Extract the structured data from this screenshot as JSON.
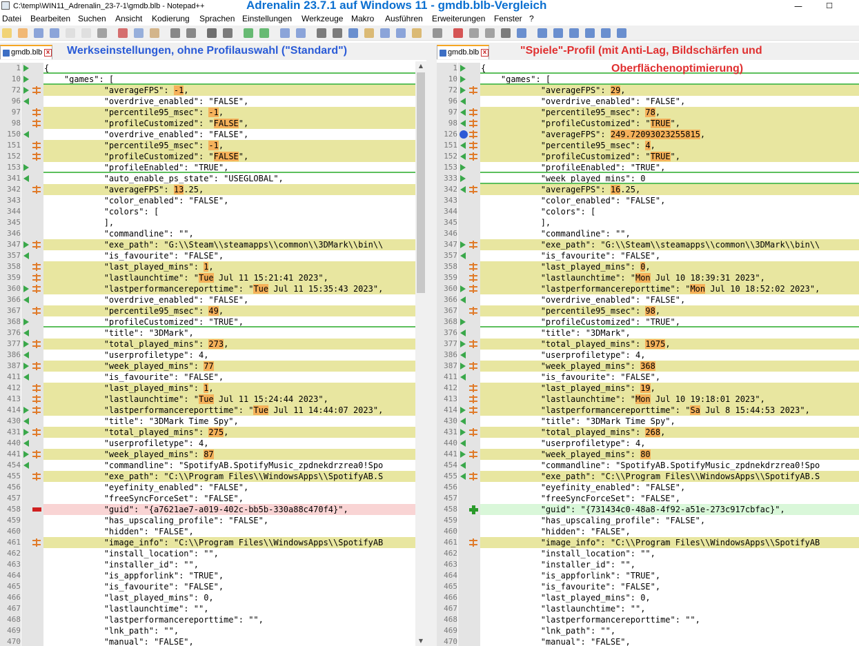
{
  "window": {
    "title": "C:\\temp\\WIN11_Adrenalin_23-7-1\\gmdb.blb - Notepad++",
    "overlay_heading": "Adrenalin 23.7.1 auf Windows 11 - gmdb.blb-Vergleich",
    "minimize_symbol": "—",
    "maximize_symbol": "☐"
  },
  "menu": [
    "Datei",
    "Bearbeiten",
    "Suchen",
    "Ansicht",
    "Kodierung",
    "Sprachen",
    "Einstellungen",
    "Werkzeuge",
    "Makro",
    "Ausführen",
    "Erweiterungen",
    "Fenster",
    "?"
  ],
  "toolbar_icons": [
    "new-icon",
    "open-icon",
    "save-icon",
    "save-all-icon",
    "close-icon",
    "close-all-icon",
    "print-icon",
    "cut-icon",
    "copy-icon",
    "paste-icon",
    "undo-icon",
    "redo-icon",
    "find-icon",
    "replace-icon",
    "zoom-in-icon",
    "zoom-out-icon",
    "sync-vertical-icon",
    "sync-horizontal-icon",
    "word-wrap-icon",
    "show-all-chars-icon",
    "indent-guide-icon",
    "udl-icon",
    "doc-map-icon",
    "function-list-icon",
    "folder-workspace-icon",
    "monitor-icon",
    "record-macro-icon",
    "stop-record-icon",
    "play-macro-icon",
    "run-macro-multiple-icon",
    "save-macro-icon",
    "compare-icon",
    "first-diff-icon",
    "prev-diff-icon",
    "next-diff-icon",
    "last-diff-icon",
    "diff-nav-icon"
  ],
  "left": {
    "tab": "gmdb.blb",
    "caption": "Werkseinstellungen, ohne Profilauswahl (\"Standard\")",
    "lines": [
      {
        "n": "1",
        "code": "{",
        "marker": "arrow-right",
        "type": "sep"
      },
      {
        "n": "10",
        "code": "    \"games\": [",
        "marker": "arrow-right-sep",
        "type": "sep"
      },
      {
        "n": "72",
        "code": "            \"averageFPS\": ",
        "hl": "-1",
        "after": ",",
        "marker": "arrow-right",
        "mk2": "changed",
        "type": "changed"
      },
      {
        "n": "96",
        "code": "            \"overdrive_enabled\": \"FALSE\",",
        "marker": "arrow-left",
        "type": "plain"
      },
      {
        "n": "97",
        "code": "            \"percentile95_msec\": ",
        "hl": "-1",
        "after": ",",
        "mk2": "changed",
        "type": "changed"
      },
      {
        "n": "98",
        "code": "            \"profileCustomized\": \"",
        "hl": "FALSE",
        "after": "\",",
        "mk2": "changed",
        "type": "changed"
      },
      {
        "n": "150",
        "code": "            \"overdrive_enabled\": \"FALSE\",",
        "marker": "arrow-left",
        "type": "plain"
      },
      {
        "n": "151",
        "code": "            \"percentile95_msec\": ",
        "hl": "-1",
        "after": ",",
        "mk2": "changed",
        "type": "changed"
      },
      {
        "n": "152",
        "code": "            \"profileCustomized\": \"",
        "hl": "FALSE",
        "after": "\",",
        "mk2": "changed",
        "type": "changed"
      },
      {
        "n": "153",
        "code": "            \"profileEnabled\": \"TRUE\",",
        "marker": "arrow-right",
        "type": "sep"
      },
      {
        "n": "341",
        "code": "            \"auto_enable_ps_state\": \"USEGLOBAL\",",
        "marker": "arrow-left",
        "type": "plain"
      },
      {
        "n": "342",
        "code": "            \"averageFPS\": ",
        "hl": "13",
        "after": ".25,",
        "mk2": "changed",
        "type": "changed"
      },
      {
        "n": "343",
        "code": "            \"color_enabled\": \"FALSE\",",
        "type": "plain"
      },
      {
        "n": "344",
        "code": "            \"colors\": [",
        "type": "plain"
      },
      {
        "n": "345",
        "code": "            ],",
        "type": "plain"
      },
      {
        "n": "346",
        "code": "            \"commandline\": \"\",",
        "type": "plain"
      },
      {
        "n": "347",
        "code": "            \"exe_path\": \"G:\\\\Steam\\\\steamapps\\\\common\\\\3DMark\\\\bin\\\\",
        "marker": "arrow-right",
        "mk2": "changed",
        "type": "changed"
      },
      {
        "n": "357",
        "code": "            \"is_favourite\": \"FALSE\",",
        "marker": "arrow-left",
        "type": "plain"
      },
      {
        "n": "358",
        "code": "            \"last_played_mins\": ",
        "hl": "1",
        "after": ",",
        "mk2": "changed",
        "type": "changed"
      },
      {
        "n": "359",
        "code": "            \"lastlaunchtime\": \"",
        "hl": "Tue",
        "after": " Jul 11 15:21:41 2023\",",
        "mk2": "changed",
        "type": "changed"
      },
      {
        "n": "360",
        "code": "            \"lastperformancereporttime\": \"",
        "hl": "Tue",
        "after": " Jul 11 15:35:43 2023\",",
        "marker": "arrow-right",
        "mk2": "changed",
        "type": "changed"
      },
      {
        "n": "366",
        "code": "            \"overdrive_enabled\": \"FALSE\",",
        "marker": "arrow-left",
        "type": "plain"
      },
      {
        "n": "367",
        "code": "            \"percentile95_msec\": ",
        "hl": "49",
        "after": ",",
        "mk2": "changed",
        "type": "changed"
      },
      {
        "n": "368",
        "code": "            \"profileCustomized\": \"TRUE\",",
        "marker": "arrow-right",
        "type": "sep"
      },
      {
        "n": "376",
        "code": "            \"title\": \"3DMark\",",
        "marker": "arrow-left",
        "type": "plain"
      },
      {
        "n": "377",
        "code": "            \"total_played_mins\": ",
        "hl": "273",
        "after": ",",
        "marker": "arrow-right",
        "mk2": "changed",
        "type": "changed"
      },
      {
        "n": "386",
        "code": "            \"userprofiletype\": 4,",
        "marker": "arrow-left",
        "type": "plain"
      },
      {
        "n": "387",
        "code": "            \"week_played_mins\": ",
        "hl": "77",
        "after": "",
        "marker": "arrow-right-sep",
        "mk2": "changed",
        "type": "changed"
      },
      {
        "n": "411",
        "code": "            \"is_favourite\": \"FALSE\",",
        "marker": "arrow-left",
        "type": "plain"
      },
      {
        "n": "412",
        "code": "            \"last_played_mins\": ",
        "hl": "1",
        "after": ",",
        "mk2": "changed",
        "type": "changed"
      },
      {
        "n": "413",
        "code": "            \"lastlaunchtime\": \"",
        "hl": "Tue",
        "after": " Jul 11 15:24:44 2023\",",
        "mk2": "changed",
        "type": "changed"
      },
      {
        "n": "414",
        "code": "            \"lastperformancereporttime\": \"",
        "hl": "Tue",
        "after": " Jul 11 14:44:07 2023\",",
        "marker": "arrow-right",
        "mk2": "changed",
        "type": "changed"
      },
      {
        "n": "430",
        "code": "            \"title\": \"3DMark Time Spy\",",
        "marker": "arrow-left",
        "type": "plain"
      },
      {
        "n": "431",
        "code": "            \"total_played_mins\": ",
        "hl": "275",
        "after": ",",
        "marker": "arrow-right",
        "mk2": "changed",
        "type": "changed"
      },
      {
        "n": "440",
        "code": "            \"userprofiletype\": 4,",
        "marker": "arrow-left",
        "type": "plain"
      },
      {
        "n": "441",
        "code": "            \"week_played_mins\": ",
        "hl": "87",
        "after": "",
        "marker": "arrow-right-sep",
        "mk2": "changed",
        "type": "changed"
      },
      {
        "n": "454",
        "code": "            \"commandline\": \"SpotifyAB.SpotifyMusic_zpdnekdrzrea0!Spo",
        "marker": "arrow-left",
        "type": "plain"
      },
      {
        "n": "455",
        "code": "            \"exe_path\": \"C:\\\\Program Files\\\\WindowsApps\\\\SpotifyAB.S",
        "mk2": "changed",
        "type": "changed"
      },
      {
        "n": "456",
        "code": "            \"eyefinity_enabled\": \"FALSE\",",
        "type": "plain"
      },
      {
        "n": "457",
        "code": "            \"freeSyncForceSet\": \"FALSE\",",
        "type": "plain"
      },
      {
        "n": "458",
        "code": "            \"guid\": \"{a7621ae7-a019-402c-bb5b-330a88c470f4}\",",
        "mk2": "removed",
        "type": "removed"
      },
      {
        "n": "459",
        "code": "            \"has_upscaling_profile\": \"FALSE\",",
        "type": "plain"
      },
      {
        "n": "460",
        "code": "            \"hidden\": \"FALSE\",",
        "type": "plain"
      },
      {
        "n": "461",
        "code": "            \"image_info\": \"C:\\\\Program Files\\\\WindowsApps\\\\SpotifyAB",
        "mk2": "changed",
        "type": "changed"
      },
      {
        "n": "462",
        "code": "            \"install_location\": \"\",",
        "type": "plain"
      },
      {
        "n": "463",
        "code": "            \"installer_id\": \"\",",
        "type": "plain"
      },
      {
        "n": "464",
        "code": "            \"is_appforlink\": \"TRUE\",",
        "type": "plain"
      },
      {
        "n": "465",
        "code": "            \"is_favourite\": \"FALSE\",",
        "type": "plain"
      },
      {
        "n": "466",
        "code": "            \"last_played_mins\": 0,",
        "type": "plain"
      },
      {
        "n": "467",
        "code": "            \"lastlaunchtime\": \"\",",
        "type": "plain"
      },
      {
        "n": "468",
        "code": "            \"lastperformancereporttime\": \"\",",
        "type": "plain"
      },
      {
        "n": "469",
        "code": "            \"lnk_path\": \"\",",
        "type": "plain"
      },
      {
        "n": "470",
        "code": "            \"manual\": \"FALSE\",",
        "type": "plain"
      }
    ]
  },
  "right": {
    "tab": "gmdb.blb",
    "caption_line1": "\"Spiele\"-Profil  (mit Anti-Lag, Bildschärfen und",
    "caption_line2": "Oberflächenoptimierung)",
    "lines": [
      {
        "n": "1",
        "code": "{",
        "marker": "arrow-right",
        "type": "sep"
      },
      {
        "n": "10",
        "code": "    \"games\": [",
        "marker": "arrow-right-sep",
        "type": "sep"
      },
      {
        "n": "72",
        "code": "            \"averageFPS\": ",
        "hl": "29",
        "after": ",",
        "marker": "arrow-right",
        "mk2": "changed",
        "type": "changed"
      },
      {
        "n": "96",
        "code": "            \"overdrive_enabled\": \"FALSE\",",
        "marker": "arrow-left",
        "type": "plain"
      },
      {
        "n": "97",
        "code": "            \"percentile95_msec\": ",
        "hl": "78",
        "after": ",",
        "marker": "arrow-left",
        "mk2": "changed",
        "type": "changed"
      },
      {
        "n": "98",
        "code": "            \"profileCustomized\": \"",
        "hl": "TRUE",
        "after": "\",",
        "marker": "arrow-left",
        "mk2": "changed",
        "type": "changed"
      },
      {
        "n": "126",
        "code": "            \"averageFPS\": ",
        "hl": "249.72093023255815",
        "after": ",",
        "marker": "dot",
        "mk2": "changed",
        "type": "changed"
      },
      {
        "n": "151",
        "code": "            \"percentile95_msec\": ",
        "hl": "4",
        "after": ",",
        "marker": "arrow-left",
        "mk2": "changed",
        "type": "changed"
      },
      {
        "n": "152",
        "code": "            \"profileCustomized\": \"",
        "hl": "TRUE",
        "after": "\",",
        "marker": "arrow-left",
        "mk2": "changed",
        "type": "changed"
      },
      {
        "n": "153",
        "code": "            \"profileEnabled\": \"TRUE\",",
        "marker": "arrow-right",
        "type": "sep"
      },
      {
        "n": "333",
        "code": "            \"week_played_mins\": 0",
        "marker": "arrow-right-sep",
        "type": "sep"
      },
      {
        "n": "342",
        "code": "            \"averageFPS\": ",
        "hl": "16",
        "after": ".25,",
        "marker": "arrow-left",
        "mk2": "changed",
        "type": "changed"
      },
      {
        "n": "343",
        "code": "            \"color_enabled\": \"FALSE\",",
        "type": "plain"
      },
      {
        "n": "344",
        "code": "            \"colors\": [",
        "type": "plain"
      },
      {
        "n": "345",
        "code": "            ],",
        "type": "plain"
      },
      {
        "n": "346",
        "code": "            \"commandline\": \"\",",
        "type": "plain"
      },
      {
        "n": "347",
        "code": "            \"exe_path\": \"G:\\\\Steam\\\\steamapps\\\\common\\\\3DMark\\\\bin\\\\",
        "marker": "arrow-right",
        "mk2": "changed",
        "type": "changed"
      },
      {
        "n": "357",
        "code": "            \"is_favourite\": \"FALSE\",",
        "marker": "arrow-left",
        "type": "plain"
      },
      {
        "n": "358",
        "code": "            \"last_played_mins\": ",
        "hl": "0",
        "after": ",",
        "mk2": "changed",
        "type": "changed"
      },
      {
        "n": "359",
        "code": "            \"lastlaunchtime\": \"",
        "hl": "Mon",
        "after": " Jul 10 18:39:31 2023\",",
        "mk2": "changed",
        "type": "changed"
      },
      {
        "n": "360",
        "code": "            \"lastperformancereporttime\": \"",
        "hl": "Mon",
        "after": " Jul 10 18:52:02 2023\",",
        "marker": "arrow-right",
        "mk2": "changed",
        "type": "changed"
      },
      {
        "n": "366",
        "code": "            \"overdrive_enabled\": \"FALSE\",",
        "marker": "arrow-left",
        "type": "plain"
      },
      {
        "n": "367",
        "code": "            \"percentile95_msec\": ",
        "hl": "98",
        "after": ",",
        "mk2": "changed",
        "type": "changed"
      },
      {
        "n": "368",
        "code": "            \"profileCustomized\": \"TRUE\",",
        "marker": "arrow-right",
        "type": "sep"
      },
      {
        "n": "376",
        "code": "            \"title\": \"3DMark\",",
        "marker": "arrow-left",
        "type": "plain"
      },
      {
        "n": "377",
        "code": "            \"total_played_mins\": ",
        "hl": "1975",
        "after": ",",
        "marker": "arrow-right",
        "mk2": "changed",
        "type": "changed"
      },
      {
        "n": "386",
        "code": "            \"userprofiletype\": 4,",
        "marker": "arrow-left",
        "type": "plain"
      },
      {
        "n": "387",
        "code": "            \"week_played_mins\": ",
        "hl": "368",
        "after": "",
        "marker": "arrow-right-sep",
        "mk2": "changed",
        "type": "changed"
      },
      {
        "n": "411",
        "code": "            \"is_favourite\": \"FALSE\",",
        "marker": "arrow-left",
        "type": "plain"
      },
      {
        "n": "412",
        "code": "            \"last_played_mins\": ",
        "hl": "19",
        "after": ",",
        "mk2": "changed",
        "type": "changed"
      },
      {
        "n": "413",
        "code": "            \"lastlaunchtime\": \"",
        "hl": "Mon",
        "after": " Jul 10 19:18:01 2023\",",
        "mk2": "changed",
        "type": "changed"
      },
      {
        "n": "414",
        "code": "            \"lastperformancereporttime\": \"",
        "hl": "Sa",
        "after": " Jul 8 15:44:53 2023\",",
        "marker": "arrow-right",
        "mk2": "changed",
        "type": "changed"
      },
      {
        "n": "430",
        "code": "            \"title\": \"3DMark Time Spy\",",
        "marker": "arrow-left",
        "type": "plain"
      },
      {
        "n": "431",
        "code": "            \"total_played_mins\": ",
        "hl": "268",
        "after": ",",
        "marker": "arrow-right",
        "mk2": "changed",
        "type": "changed"
      },
      {
        "n": "440",
        "code": "            \"userprofiletype\": 4,",
        "marker": "arrow-left",
        "type": "plain"
      },
      {
        "n": "441",
        "code": "            \"week_played_mins\": ",
        "hl": "80",
        "after": "",
        "marker": "arrow-right-sep",
        "mk2": "changed",
        "type": "changed"
      },
      {
        "n": "454",
        "code": "            \"commandline\": \"SpotifyAB.SpotifyMusic_zpdnekdrzrea0!Spo",
        "marker": "arrow-left",
        "type": "plain"
      },
      {
        "n": "455",
        "code": "            \"exe_path\": \"C:\\\\Program Files\\\\WindowsApps\\\\SpotifyAB.S",
        "marker": "arrow-left",
        "mk2": "changed",
        "type": "changed"
      },
      {
        "n": "456",
        "code": "            \"eyefinity_enabled\": \"FALSE\",",
        "type": "plain"
      },
      {
        "n": "457",
        "code": "            \"freeSyncForceSet\": \"FALSE\",",
        "type": "plain"
      },
      {
        "n": "458",
        "code": "            \"guid\": \"{731434c0-48a8-4f92-a51e-273c917cbfac}\",",
        "mk2": "added",
        "type": "added"
      },
      {
        "n": "459",
        "code": "            \"has_upscaling_profile\": \"FALSE\",",
        "type": "plain"
      },
      {
        "n": "460",
        "code": "            \"hidden\": \"FALSE\",",
        "type": "plain"
      },
      {
        "n": "461",
        "code": "            \"image_info\": \"C:\\\\Program Files\\\\WindowsApps\\\\SpotifyAB",
        "mk2": "changed",
        "type": "changed"
      },
      {
        "n": "462",
        "code": "            \"install_location\": \"\",",
        "type": "plain"
      },
      {
        "n": "463",
        "code": "            \"installer_id\": \"\",",
        "type": "plain"
      },
      {
        "n": "464",
        "code": "            \"is_appforlink\": \"TRUE\",",
        "type": "plain"
      },
      {
        "n": "465",
        "code": "            \"is_favourite\": \"FALSE\",",
        "type": "plain"
      },
      {
        "n": "466",
        "code": "            \"last_played_mins\": 0,",
        "type": "plain"
      },
      {
        "n": "467",
        "code": "            \"lastlaunchtime\": \"\",",
        "type": "plain"
      },
      {
        "n": "468",
        "code": "            \"lastperformancereporttime\": \"\",",
        "type": "plain"
      },
      {
        "n": "469",
        "code": "            \"lnk_path\": \"\",",
        "type": "plain"
      },
      {
        "n": "470",
        "code": "            \"manual\": \"FALSE\",",
        "type": "plain"
      }
    ]
  },
  "colors": {
    "changed_bg": "#e8e6a0",
    "highlight": "#f5b15a",
    "removed_bg": "#f9d4d4",
    "added_bg": "#d9f7d9",
    "overlay_blue": "#0b6fd0",
    "left_caption": "#2a5bd7",
    "right_caption": "#e03030"
  }
}
